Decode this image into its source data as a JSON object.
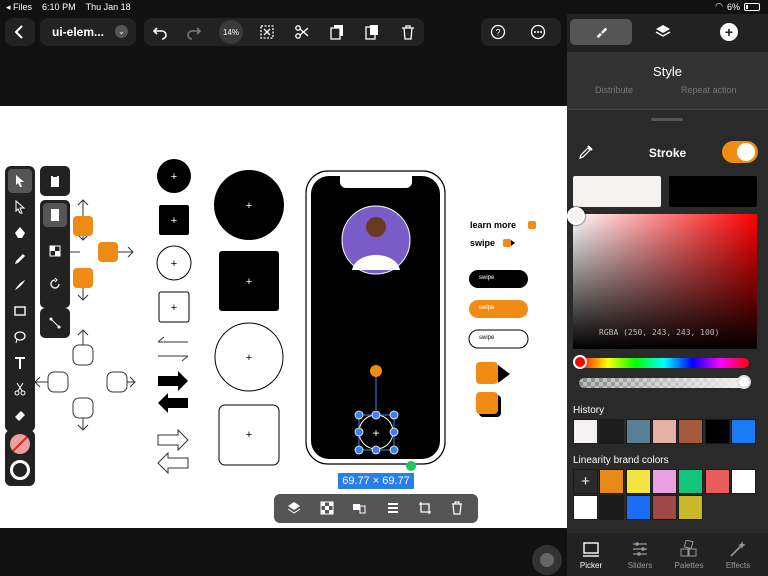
{
  "status": {
    "app": "Files",
    "time": "6:10 PM",
    "date": "Thu Jan 18",
    "battery": "6%"
  },
  "toolbar": {
    "doc_title": "ui-elem...",
    "zoom": "14%"
  },
  "panel": {
    "title": "Style",
    "hidden_left": "Distribute",
    "hidden_right": "Repeat action",
    "stroke_label": "Stroke",
    "rgba_readout": "RGBA (250, 243, 243, 100)",
    "history_label": "History",
    "brand_label": "Linearity brand colors",
    "history_colors": [
      "#f7f2f2",
      "#1c1c1c",
      "#5a7f94",
      "#e5b1a4",
      "#a55a3c",
      "#000000",
      "#1a7cf5"
    ],
    "brand_colors_row1": [
      "#e88a1a",
      "#f5e542",
      "#e8a0e0",
      "#14c47a",
      "#e85c5c",
      "#ffffff"
    ],
    "brand_colors_row2": [
      "#ffffff",
      "#1a1a1a",
      "#1a6ef5",
      "#a04848",
      "#c9b82a"
    ]
  },
  "tabs": [
    {
      "label": "Picker"
    },
    {
      "label": "Sliders"
    },
    {
      "label": "Palettes"
    },
    {
      "label": "Effects"
    }
  ],
  "canvas": {
    "learn_more": "learn more",
    "swipe": "swipe",
    "swipe_pill": "swipe",
    "dimension": "69.77 × 69.77"
  }
}
